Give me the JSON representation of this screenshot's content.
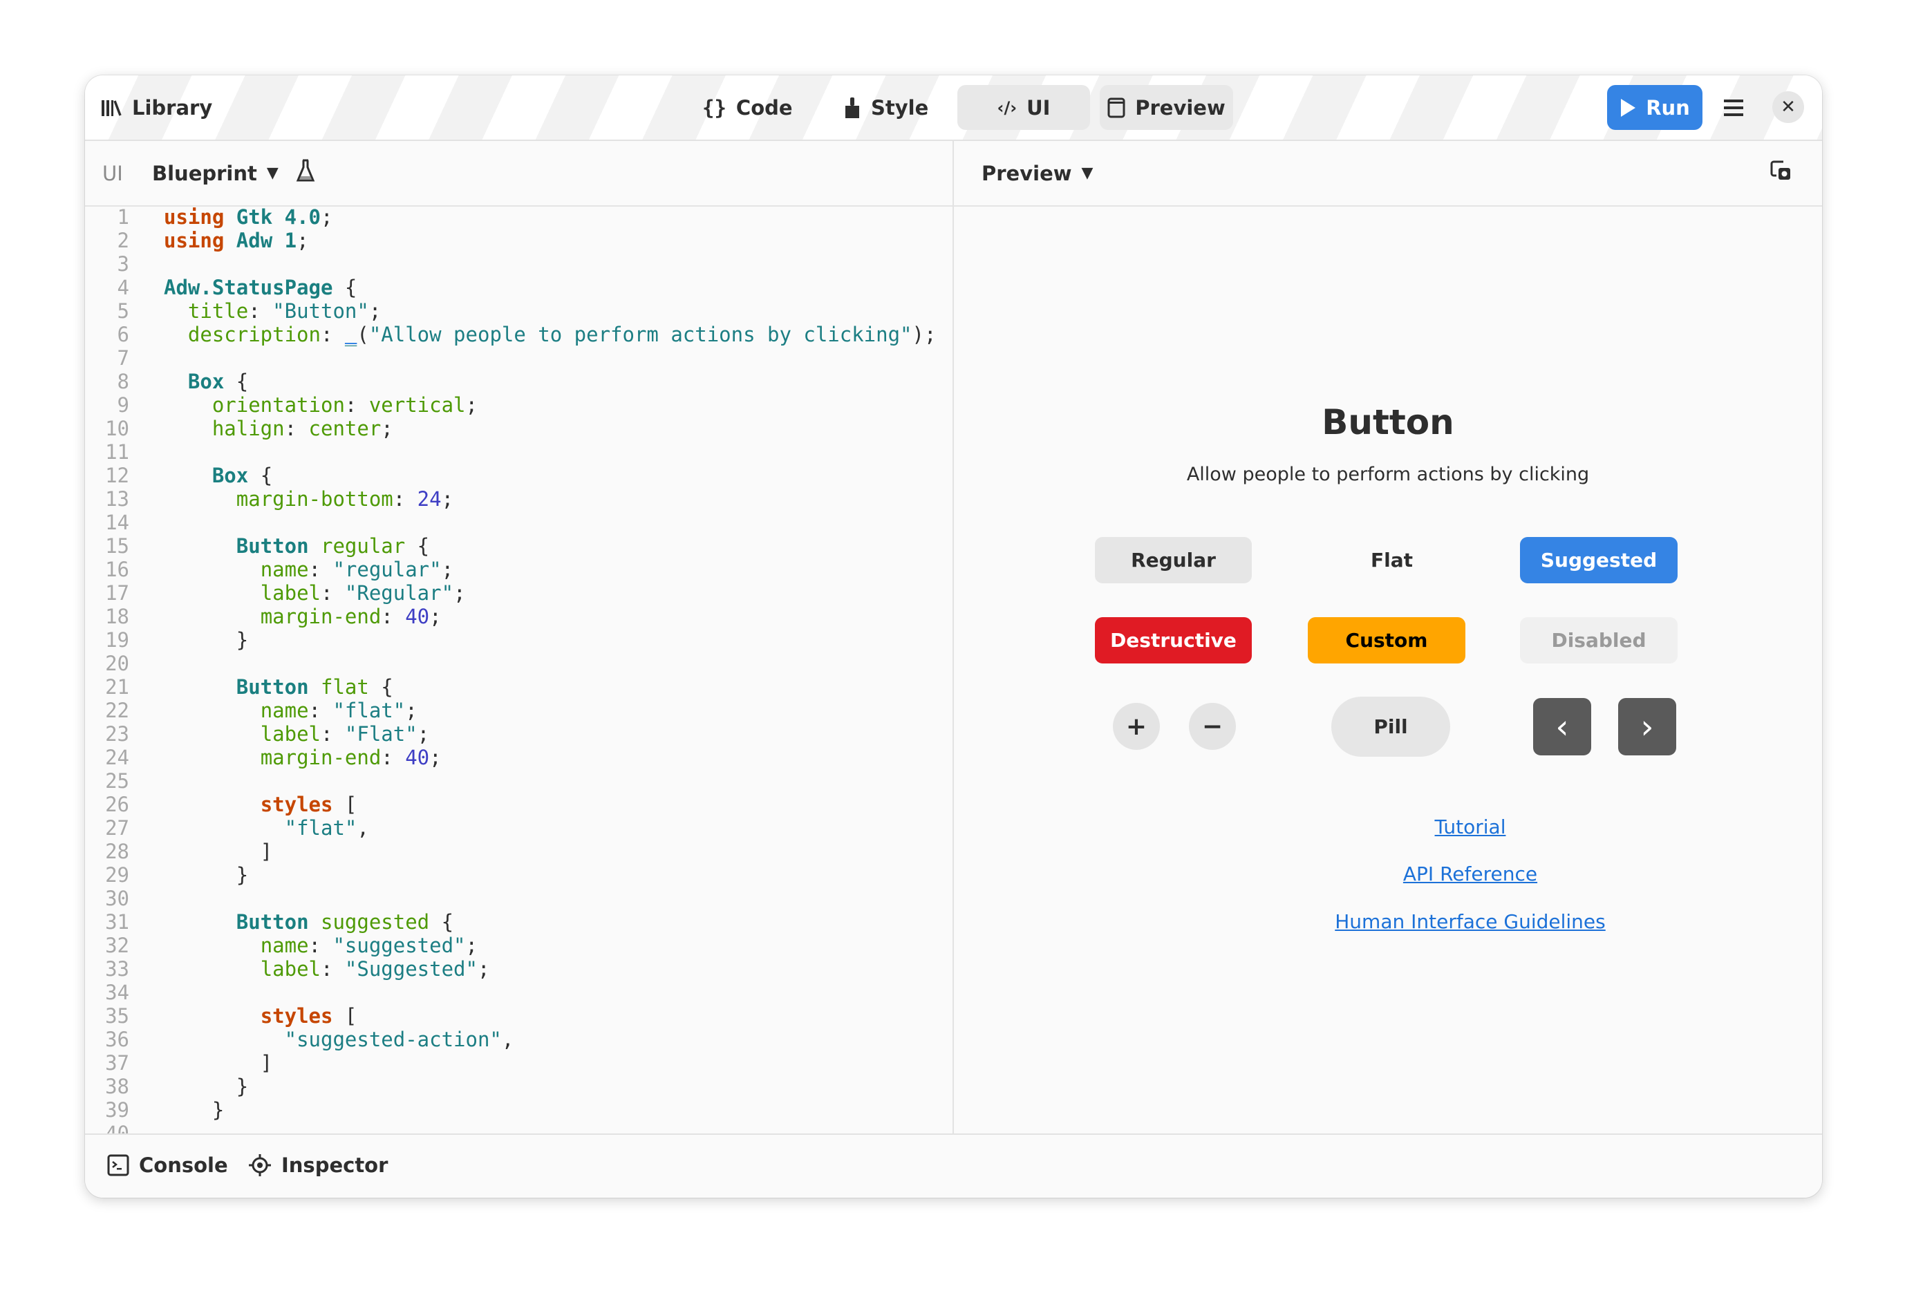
{
  "header": {
    "library_label": "Library",
    "code_tab": "Code",
    "style_tab": "Style",
    "ui_tab": "UI",
    "preview_tab": "Preview",
    "run_label": "Run"
  },
  "editor_toolbar": {
    "ui_label": "UI",
    "language_select": "Blueprint"
  },
  "preview_toolbar": {
    "mode_select": "Preview"
  },
  "code_lines": [
    [
      [
        "kw",
        "using"
      ],
      [
        "pu",
        " "
      ],
      [
        "ty",
        "Gtk 4.0"
      ],
      [
        "pu",
        ";"
      ]
    ],
    [
      [
        "kw",
        "using"
      ],
      [
        "pu",
        " "
      ],
      [
        "ty",
        "Adw 1"
      ],
      [
        "pu",
        ";"
      ]
    ],
    [],
    [
      [
        "ty",
        "Adw.StatusPage"
      ],
      [
        "pu",
        " {"
      ]
    ],
    [
      [
        "pu",
        "  "
      ],
      [
        "pr",
        "title"
      ],
      [
        "pu",
        ": "
      ],
      [
        "st",
        "\"Button\""
      ],
      [
        "pu",
        ";"
      ]
    ],
    [
      [
        "pu",
        "  "
      ],
      [
        "pr",
        "description"
      ],
      [
        "pu",
        ": "
      ],
      [
        "fn",
        "_"
      ],
      [
        "pu",
        "("
      ],
      [
        "st",
        "\"Allow people to perform actions by clicking\""
      ],
      [
        "pu",
        ");"
      ]
    ],
    [],
    [
      [
        "pu",
        "  "
      ],
      [
        "ty",
        "Box"
      ],
      [
        "pu",
        " {"
      ]
    ],
    [
      [
        "pu",
        "    "
      ],
      [
        "pr",
        "orientation"
      ],
      [
        "pu",
        ": "
      ],
      [
        "pr",
        "vertical"
      ],
      [
        "pu",
        ";"
      ]
    ],
    [
      [
        "pu",
        "    "
      ],
      [
        "pr",
        "halign"
      ],
      [
        "pu",
        ": "
      ],
      [
        "pr",
        "center"
      ],
      [
        "pu",
        ";"
      ]
    ],
    [],
    [
      [
        "pu",
        "    "
      ],
      [
        "ty",
        "Box"
      ],
      [
        "pu",
        " {"
      ]
    ],
    [
      [
        "pu",
        "      "
      ],
      [
        "pr",
        "margin-bottom"
      ],
      [
        "pu",
        ": "
      ],
      [
        "nu",
        "24"
      ],
      [
        "pu",
        ";"
      ]
    ],
    [],
    [
      [
        "pu",
        "      "
      ],
      [
        "ty",
        "Button"
      ],
      [
        "pu",
        " "
      ],
      [
        "pr",
        "regular"
      ],
      [
        "pu",
        " {"
      ]
    ],
    [
      [
        "pu",
        "        "
      ],
      [
        "pr",
        "name"
      ],
      [
        "pu",
        ": "
      ],
      [
        "st",
        "\"regular\""
      ],
      [
        "pu",
        ";"
      ]
    ],
    [
      [
        "pu",
        "        "
      ],
      [
        "pr",
        "label"
      ],
      [
        "pu",
        ": "
      ],
      [
        "st",
        "\"Regular\""
      ],
      [
        "pu",
        ";"
      ]
    ],
    [
      [
        "pu",
        "        "
      ],
      [
        "pr",
        "margin-end"
      ],
      [
        "pu",
        ": "
      ],
      [
        "nu",
        "40"
      ],
      [
        "pu",
        ";"
      ]
    ],
    [
      [
        "pu",
        "      }"
      ]
    ],
    [],
    [
      [
        "pu",
        "      "
      ],
      [
        "ty",
        "Button"
      ],
      [
        "pu",
        " "
      ],
      [
        "pr",
        "flat"
      ],
      [
        "pu",
        " {"
      ]
    ],
    [
      [
        "pu",
        "        "
      ],
      [
        "pr",
        "name"
      ],
      [
        "pu",
        ": "
      ],
      [
        "st",
        "\"flat\""
      ],
      [
        "pu",
        ";"
      ]
    ],
    [
      [
        "pu",
        "        "
      ],
      [
        "pr",
        "label"
      ],
      [
        "pu",
        ": "
      ],
      [
        "st",
        "\"Flat\""
      ],
      [
        "pu",
        ";"
      ]
    ],
    [
      [
        "pu",
        "        "
      ],
      [
        "pr",
        "margin-end"
      ],
      [
        "pu",
        ": "
      ],
      [
        "nu",
        "40"
      ],
      [
        "pu",
        ";"
      ]
    ],
    [],
    [
      [
        "pu",
        "        "
      ],
      [
        "kw",
        "styles"
      ],
      [
        "pu",
        " ["
      ]
    ],
    [
      [
        "pu",
        "          "
      ],
      [
        "st",
        "\"flat\""
      ],
      [
        "pu",
        ","
      ]
    ],
    [
      [
        "pu",
        "        ]"
      ]
    ],
    [
      [
        "pu",
        "      }"
      ]
    ],
    [],
    [
      [
        "pu",
        "      "
      ],
      [
        "ty",
        "Button"
      ],
      [
        "pu",
        " "
      ],
      [
        "pr",
        "suggested"
      ],
      [
        "pu",
        " {"
      ]
    ],
    [
      [
        "pu",
        "        "
      ],
      [
        "pr",
        "name"
      ],
      [
        "pu",
        ": "
      ],
      [
        "st",
        "\"suggested\""
      ],
      [
        "pu",
        ";"
      ]
    ],
    [
      [
        "pu",
        "        "
      ],
      [
        "pr",
        "label"
      ],
      [
        "pu",
        ": "
      ],
      [
        "st",
        "\"Suggested\""
      ],
      [
        "pu",
        ";"
      ]
    ],
    [],
    [
      [
        "pu",
        "        "
      ],
      [
        "kw",
        "styles"
      ],
      [
        "pu",
        " ["
      ]
    ],
    [
      [
        "pu",
        "          "
      ],
      [
        "st",
        "\"suggested-action\""
      ],
      [
        "pu",
        ","
      ]
    ],
    [
      [
        "pu",
        "        ]"
      ]
    ],
    [
      [
        "pu",
        "      }"
      ]
    ],
    [
      [
        "pu",
        "    }"
      ]
    ],
    []
  ],
  "preview": {
    "title": "Button",
    "description": "Allow people to perform actions by clicking",
    "buttons": {
      "regular": "Regular",
      "flat": "Flat",
      "suggested": "Suggested",
      "destructive": "Destructive",
      "custom": "Custom",
      "disabled": "Disabled",
      "plus": "+",
      "minus": "−",
      "pill": "Pill",
      "prev": "‹",
      "next": "›"
    },
    "links": [
      "Tutorial",
      "API Reference",
      "Human Interface Guidelines"
    ]
  },
  "bottom": {
    "console_label": "Console",
    "inspector_label": "Inspector"
  },
  "colors": {
    "accent": "#3584e4",
    "destructive": "#e01b24",
    "custom": "#ffa500",
    "link": "#1c71d8",
    "keyword": "#c64600",
    "type": "#1a7f80",
    "property": "#4e9a06",
    "number": "#3e3ec4"
  },
  "icons": {
    "library": "library-icon",
    "code": "braces-icon",
    "style": "brush-icon",
    "ui": "code-tag-icon",
    "preview": "window-icon",
    "run": "play-icon",
    "menu": "hamburger-icon",
    "close": "close-icon",
    "flask": "flask-icon",
    "screenshot": "screenshot-icon",
    "console": "terminal-icon",
    "inspector": "crosshair-icon"
  }
}
